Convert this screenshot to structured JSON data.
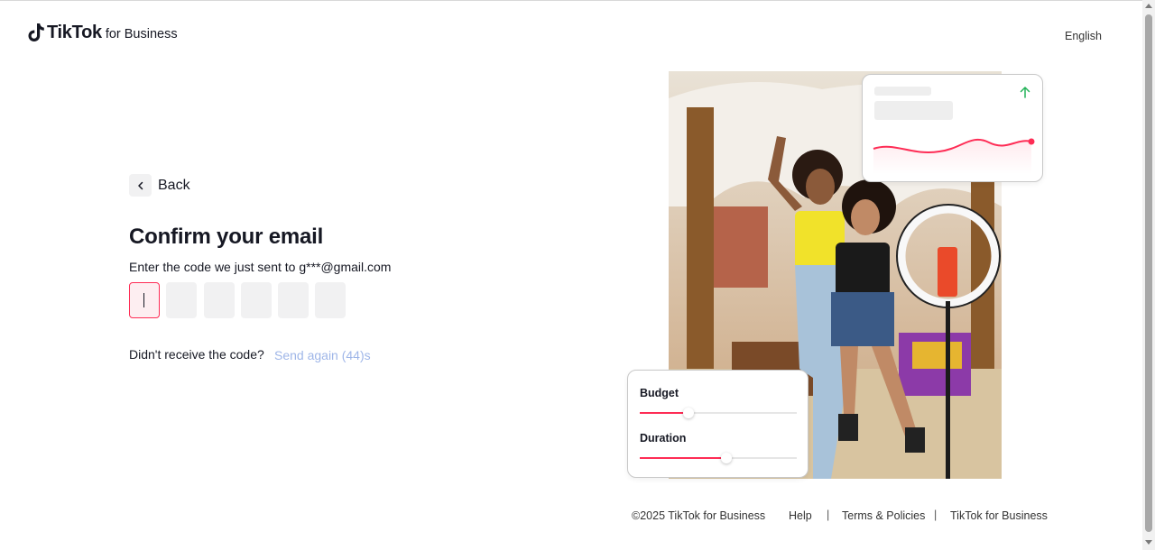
{
  "header": {
    "brand": "TikTok",
    "brand_sub": "for Business",
    "language": "English"
  },
  "form": {
    "back_label": "Back",
    "title": "Confirm your email",
    "subtitle": "Enter the code we just sent to g***@gmail.com",
    "code_length": 6,
    "resend_question": "Didn't receive the code?",
    "resend_link": "Send again (44)s"
  },
  "illustration": {
    "sliders": [
      {
        "label": "Budget",
        "value_fraction": 0.31
      },
      {
        "label": "Duration",
        "value_fraction": 0.55
      }
    ]
  },
  "footer": {
    "copyright": "©2025 TikTok for Business",
    "links": [
      "Help",
      "Terms & Policies",
      "TikTok for Business"
    ]
  },
  "colors": {
    "accent": "#fe2c55",
    "link_disabled": "#9fb6e8",
    "trend_up": "#25b35a"
  },
  "icons": {
    "logo": "tiktok-note-icon",
    "back": "chevron-left-icon",
    "trend": "arrow-up-icon"
  }
}
